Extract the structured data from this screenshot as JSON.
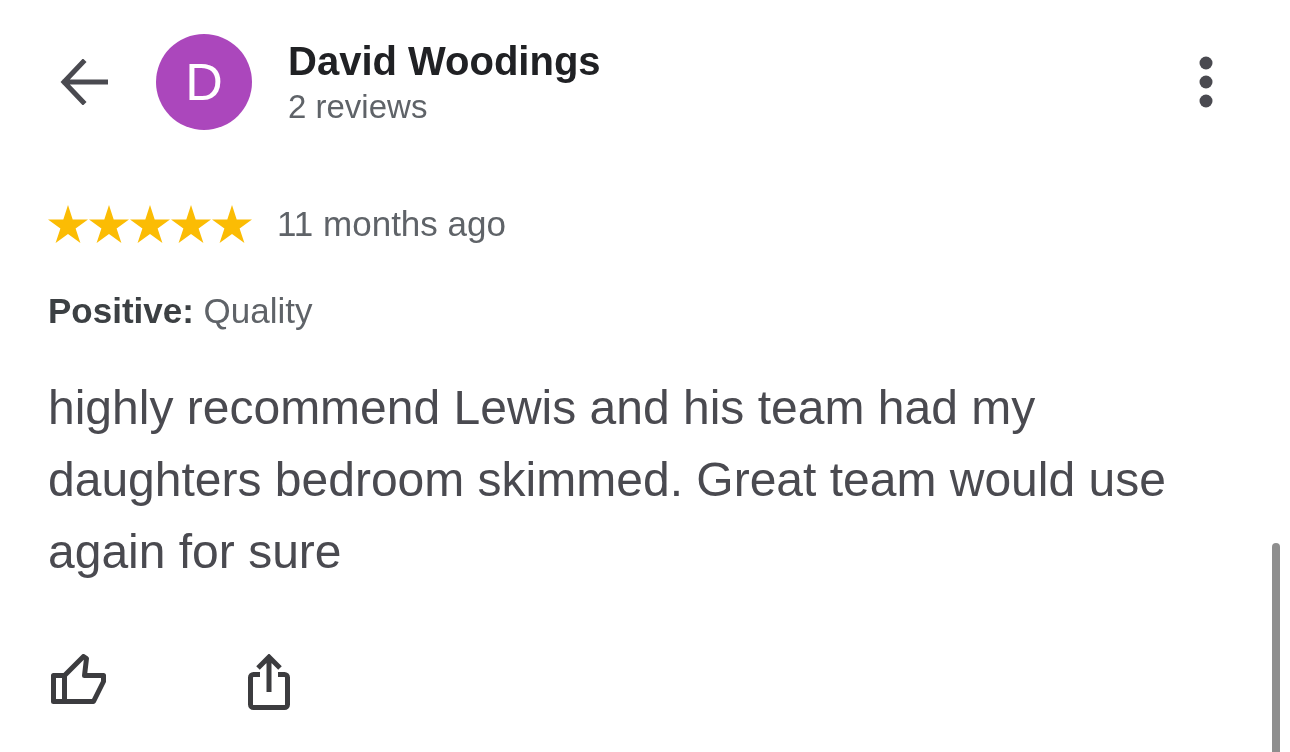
{
  "reviewer": {
    "avatar_letter": "D",
    "name": "David Woodings",
    "review_count": "2 reviews"
  },
  "review": {
    "stars": 5,
    "time": "11 months ago",
    "highlight": "**Positive:** Quality",
    "text": "highly recommend Lewis and his team had my daughters bedroom skimmed. Great team would use again for sure"
  }
}
